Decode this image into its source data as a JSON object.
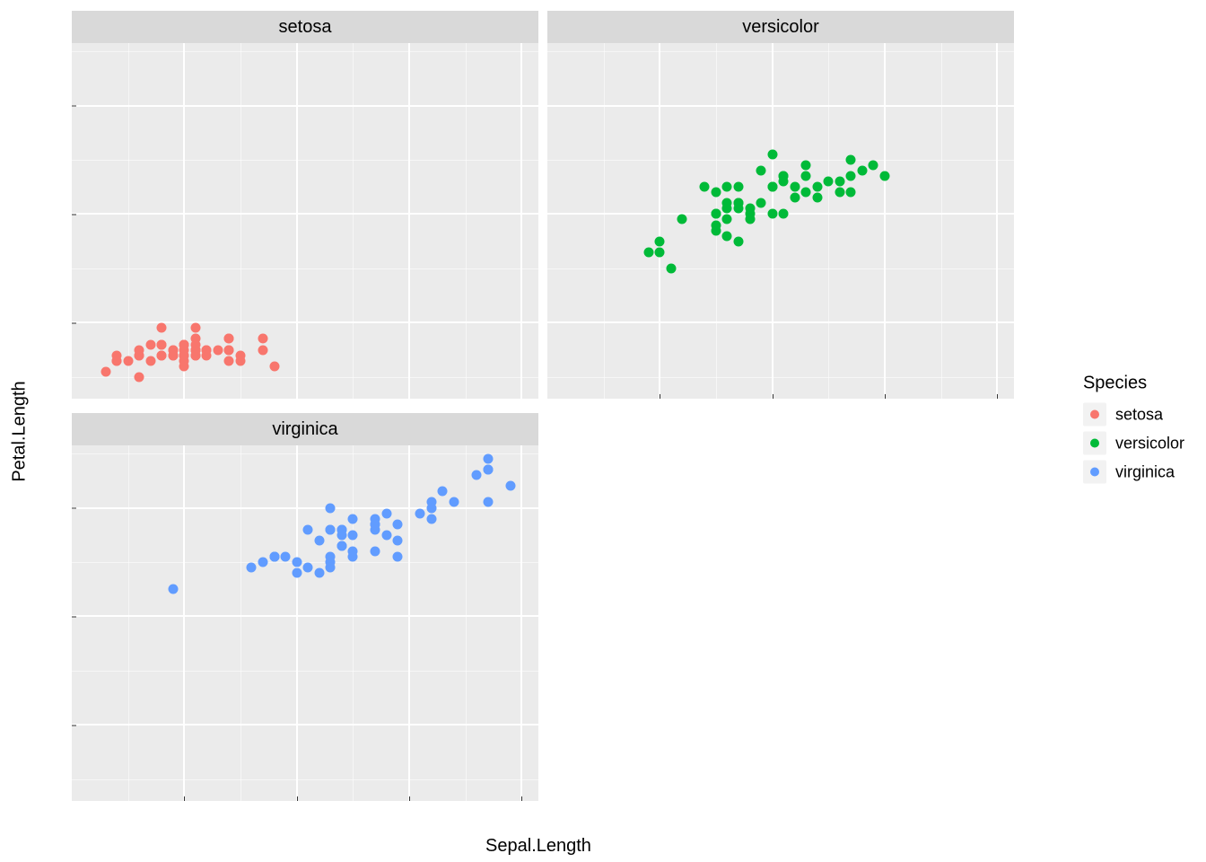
{
  "xlabel": "Sepal.Length",
  "ylabel": "Petal.Length",
  "legend": {
    "title": "Species",
    "items": [
      {
        "name": "setosa",
        "color": "#F8766D"
      },
      {
        "name": "versicolor",
        "color": "#00BA38"
      },
      {
        "name": "virginica",
        "color": "#619CFF"
      }
    ]
  },
  "facets": [
    "setosa",
    "versicolor",
    "virginica"
  ],
  "chart_data": {
    "type": "scatter",
    "xlabel": "Sepal.Length",
    "ylabel": "Petal.Length",
    "facet_by": "Species",
    "xlim": [
      4.0,
      8.15
    ],
    "ylim": [
      0.6,
      7.15
    ],
    "x_ticks": [
      5,
      6,
      7,
      8
    ],
    "y_ticks": [
      2,
      4,
      6
    ],
    "series": [
      {
        "name": "setosa",
        "facet": "setosa",
        "color": "#F8766D",
        "points": [
          [
            5.1,
            1.4
          ],
          [
            4.9,
            1.4
          ],
          [
            4.7,
            1.3
          ],
          [
            4.6,
            1.5
          ],
          [
            5.0,
            1.4
          ],
          [
            5.4,
            1.7
          ],
          [
            4.6,
            1.4
          ],
          [
            5.0,
            1.5
          ],
          [
            4.4,
            1.4
          ],
          [
            4.9,
            1.5
          ],
          [
            5.4,
            1.5
          ],
          [
            4.8,
            1.6
          ],
          [
            4.8,
            1.4
          ],
          [
            4.3,
            1.1
          ],
          [
            5.8,
            1.2
          ],
          [
            5.7,
            1.5
          ],
          [
            5.4,
            1.3
          ],
          [
            5.1,
            1.4
          ],
          [
            5.7,
            1.7
          ],
          [
            5.1,
            1.5
          ],
          [
            5.4,
            1.7
          ],
          [
            5.1,
            1.5
          ],
          [
            4.6,
            1.0
          ],
          [
            5.1,
            1.7
          ],
          [
            4.8,
            1.9
          ],
          [
            5.0,
            1.6
          ],
          [
            5.0,
            1.6
          ],
          [
            5.2,
            1.5
          ],
          [
            5.2,
            1.4
          ],
          [
            4.7,
            1.6
          ],
          [
            4.8,
            1.6
          ],
          [
            5.4,
            1.5
          ],
          [
            5.2,
            1.5
          ],
          [
            5.5,
            1.4
          ],
          [
            4.9,
            1.5
          ],
          [
            5.0,
            1.2
          ],
          [
            5.5,
            1.3
          ],
          [
            4.9,
            1.4
          ],
          [
            4.4,
            1.3
          ],
          [
            5.1,
            1.5
          ],
          [
            5.0,
            1.3
          ],
          [
            4.5,
            1.3
          ],
          [
            4.4,
            1.3
          ],
          [
            5.0,
            1.6
          ],
          [
            5.1,
            1.9
          ],
          [
            4.8,
            1.4
          ],
          [
            5.1,
            1.6
          ],
          [
            4.6,
            1.4
          ],
          [
            5.3,
            1.5
          ],
          [
            5.0,
            1.4
          ]
        ]
      },
      {
        "name": "versicolor",
        "facet": "versicolor",
        "color": "#00BA38",
        "points": [
          [
            7.0,
            4.7
          ],
          [
            6.4,
            4.5
          ],
          [
            6.9,
            4.9
          ],
          [
            5.5,
            4.0
          ],
          [
            6.5,
            4.6
          ],
          [
            5.7,
            4.5
          ],
          [
            6.3,
            4.7
          ],
          [
            4.9,
            3.3
          ],
          [
            6.6,
            4.6
          ],
          [
            5.2,
            3.9
          ],
          [
            5.0,
            3.5
          ],
          [
            5.9,
            4.2
          ],
          [
            6.0,
            4.0
          ],
          [
            6.1,
            4.7
          ],
          [
            5.6,
            3.6
          ],
          [
            6.7,
            4.4
          ],
          [
            5.6,
            4.5
          ],
          [
            5.8,
            4.1
          ],
          [
            6.2,
            4.5
          ],
          [
            5.6,
            3.9
          ],
          [
            5.9,
            4.8
          ],
          [
            6.1,
            4.0
          ],
          [
            6.3,
            4.9
          ],
          [
            6.1,
            4.7
          ],
          [
            6.4,
            4.3
          ],
          [
            6.6,
            4.4
          ],
          [
            6.8,
            4.8
          ],
          [
            6.7,
            5.0
          ],
          [
            6.0,
            4.5
          ],
          [
            5.7,
            3.5
          ],
          [
            5.5,
            3.8
          ],
          [
            5.5,
            3.7
          ],
          [
            5.8,
            3.9
          ],
          [
            6.0,
            5.1
          ],
          [
            5.4,
            4.5
          ],
          [
            6.0,
            4.5
          ],
          [
            6.7,
            4.7
          ],
          [
            6.3,
            4.4
          ],
          [
            5.6,
            4.1
          ],
          [
            5.5,
            4.0
          ],
          [
            5.5,
            4.4
          ],
          [
            6.1,
            4.6
          ],
          [
            5.8,
            4.0
          ],
          [
            5.0,
            3.3
          ],
          [
            5.6,
            4.2
          ],
          [
            5.7,
            4.2
          ],
          [
            5.7,
            4.2
          ],
          [
            6.2,
            4.3
          ],
          [
            5.1,
            3.0
          ],
          [
            5.7,
            4.1
          ]
        ]
      },
      {
        "name": "virginica",
        "facet": "virginica",
        "color": "#619CFF",
        "points": [
          [
            6.3,
            6.0
          ],
          [
            5.8,
            5.1
          ],
          [
            7.1,
            5.9
          ],
          [
            6.3,
            5.6
          ],
          [
            6.5,
            5.8
          ],
          [
            7.6,
            6.6
          ],
          [
            4.9,
            4.5
          ],
          [
            7.3,
            6.3
          ],
          [
            6.7,
            5.8
          ],
          [
            7.2,
            6.1
          ],
          [
            6.5,
            5.1
          ],
          [
            6.4,
            5.3
          ],
          [
            6.8,
            5.5
          ],
          [
            5.7,
            5.0
          ],
          [
            5.8,
            5.1
          ],
          [
            6.4,
            5.3
          ],
          [
            6.5,
            5.5
          ],
          [
            7.7,
            6.7
          ],
          [
            7.7,
            6.9
          ],
          [
            6.0,
            5.0
          ],
          [
            6.9,
            5.7
          ],
          [
            5.6,
            4.9
          ],
          [
            7.7,
            6.7
          ],
          [
            6.3,
            4.9
          ],
          [
            6.7,
            5.7
          ],
          [
            7.2,
            6.0
          ],
          [
            6.2,
            4.8
          ],
          [
            6.1,
            4.9
          ],
          [
            6.4,
            5.6
          ],
          [
            7.2,
            5.8
          ],
          [
            7.4,
            6.1
          ],
          [
            7.9,
            6.4
          ],
          [
            6.4,
            5.6
          ],
          [
            6.3,
            5.1
          ],
          [
            6.1,
            5.6
          ],
          [
            7.7,
            6.1
          ],
          [
            6.3,
            5.6
          ],
          [
            6.4,
            5.5
          ],
          [
            6.0,
            4.8
          ],
          [
            6.9,
            5.4
          ],
          [
            6.7,
            5.6
          ],
          [
            6.9,
            5.1
          ],
          [
            5.8,
            5.1
          ],
          [
            6.8,
            5.9
          ],
          [
            6.7,
            5.7
          ],
          [
            6.7,
            5.2
          ],
          [
            6.3,
            5.0
          ],
          [
            6.5,
            5.2
          ],
          [
            6.2,
            5.4
          ],
          [
            5.9,
            5.1
          ]
        ]
      }
    ]
  }
}
